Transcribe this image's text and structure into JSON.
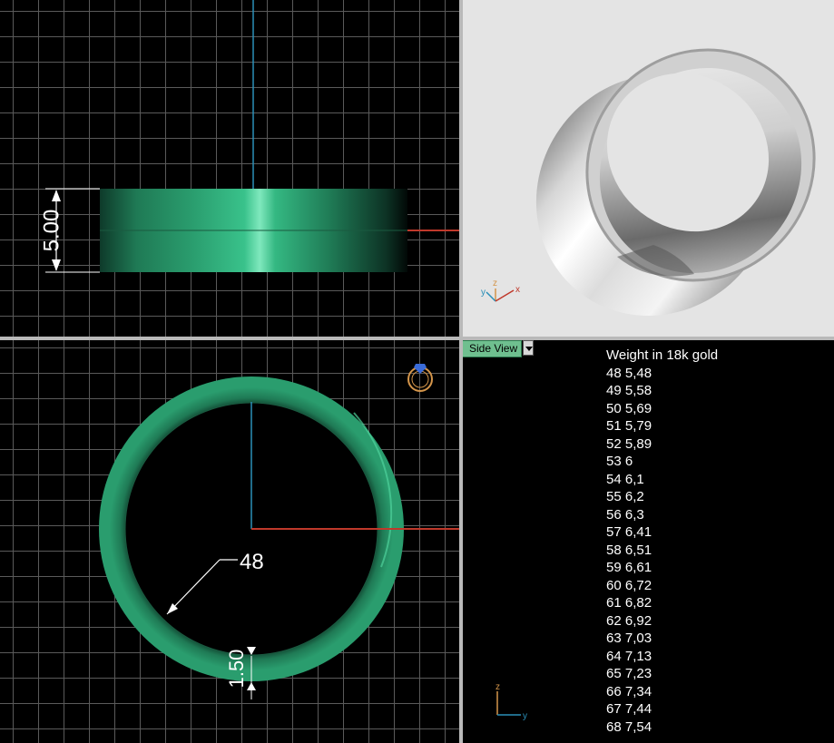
{
  "viewports": {
    "side": {
      "label": "Side View"
    }
  },
  "dimensions": {
    "height": "5.00",
    "ring_size": "48",
    "thickness": "1.50"
  },
  "weight_table": {
    "title": "Weight in 18k gold",
    "rows": [
      "48 5,48",
      "49 5,58",
      "50 5,69",
      "51 5,79",
      "52 5,89",
      "53 6",
      "54 6,1",
      "55 6,2",
      "56 6,3",
      "57 6,41",
      "58 6,51",
      "59 6,61",
      "60 6,72",
      "61 6,82",
      "62 6,92",
      "63 7,03",
      "64 7,13",
      "65 7,23",
      "66 7,34",
      "67 7,44",
      "68 7,54"
    ]
  },
  "axes": {
    "x": "x",
    "y": "y",
    "z": "z"
  },
  "colors": {
    "ring_green": "#2a9d6e",
    "axis_red": "#c0392b",
    "axis_blue": "#2a8fb8",
    "persp_bg": "#e4e4e4",
    "gem_icon": "#d4954a"
  },
  "icons": {
    "gem_ring": "ring-gem-icon"
  }
}
